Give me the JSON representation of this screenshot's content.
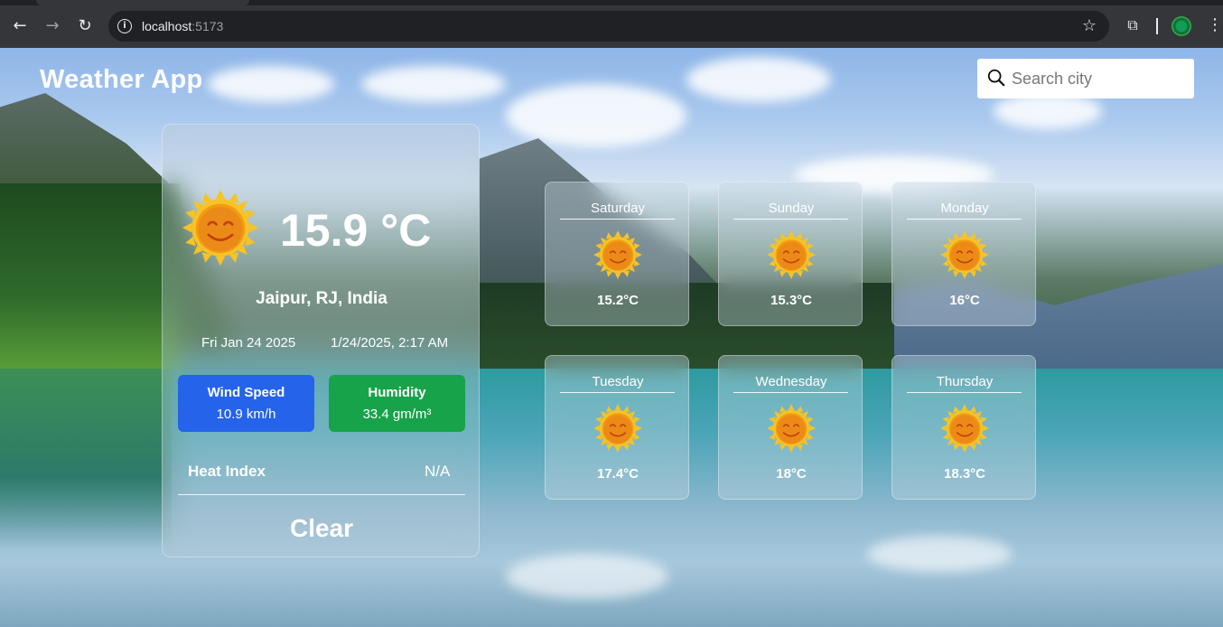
{
  "browser": {
    "url_host": "localhost",
    "url_port": ":5173",
    "icons": [
      "back-arrow-icon",
      "forward-arrow-icon",
      "reload-icon",
      "info-icon",
      "star-icon",
      "extensions-icon",
      "profile-icon",
      "menu-icon"
    ]
  },
  "header": {
    "title": "Weather App",
    "search_placeholder": "Search city"
  },
  "current": {
    "icon": "sun-face-icon",
    "temperature": "15.9 °C",
    "location": "Jaipur, RJ, India",
    "date": "Fri Jan 24 2025",
    "datetime": "1/24/2025, 2:17 AM",
    "wind": {
      "label": "Wind Speed",
      "value": "10.9 km/h",
      "color": "#2563eb"
    },
    "humidity": {
      "label": "Humidity",
      "value": "33.4 gm/m³",
      "color": "#16a34a"
    },
    "heat_index": {
      "label": "Heat Index",
      "value": "N/A"
    },
    "clear_label": "Clear"
  },
  "forecast": [
    {
      "day": "Saturday",
      "temp": "15.2°C",
      "icon": "sun-face-icon"
    },
    {
      "day": "Sunday",
      "temp": "15.3°C",
      "icon": "sun-face-icon"
    },
    {
      "day": "Monday",
      "temp": "16°C",
      "icon": "sun-face-icon"
    },
    {
      "day": "Tuesday",
      "temp": "17.4°C",
      "icon": "sun-face-icon"
    },
    {
      "day": "Wednesday",
      "temp": "18°C",
      "icon": "sun-face-icon"
    },
    {
      "day": "Thursday",
      "temp": "18.3°C",
      "icon": "sun-face-icon"
    }
  ]
}
